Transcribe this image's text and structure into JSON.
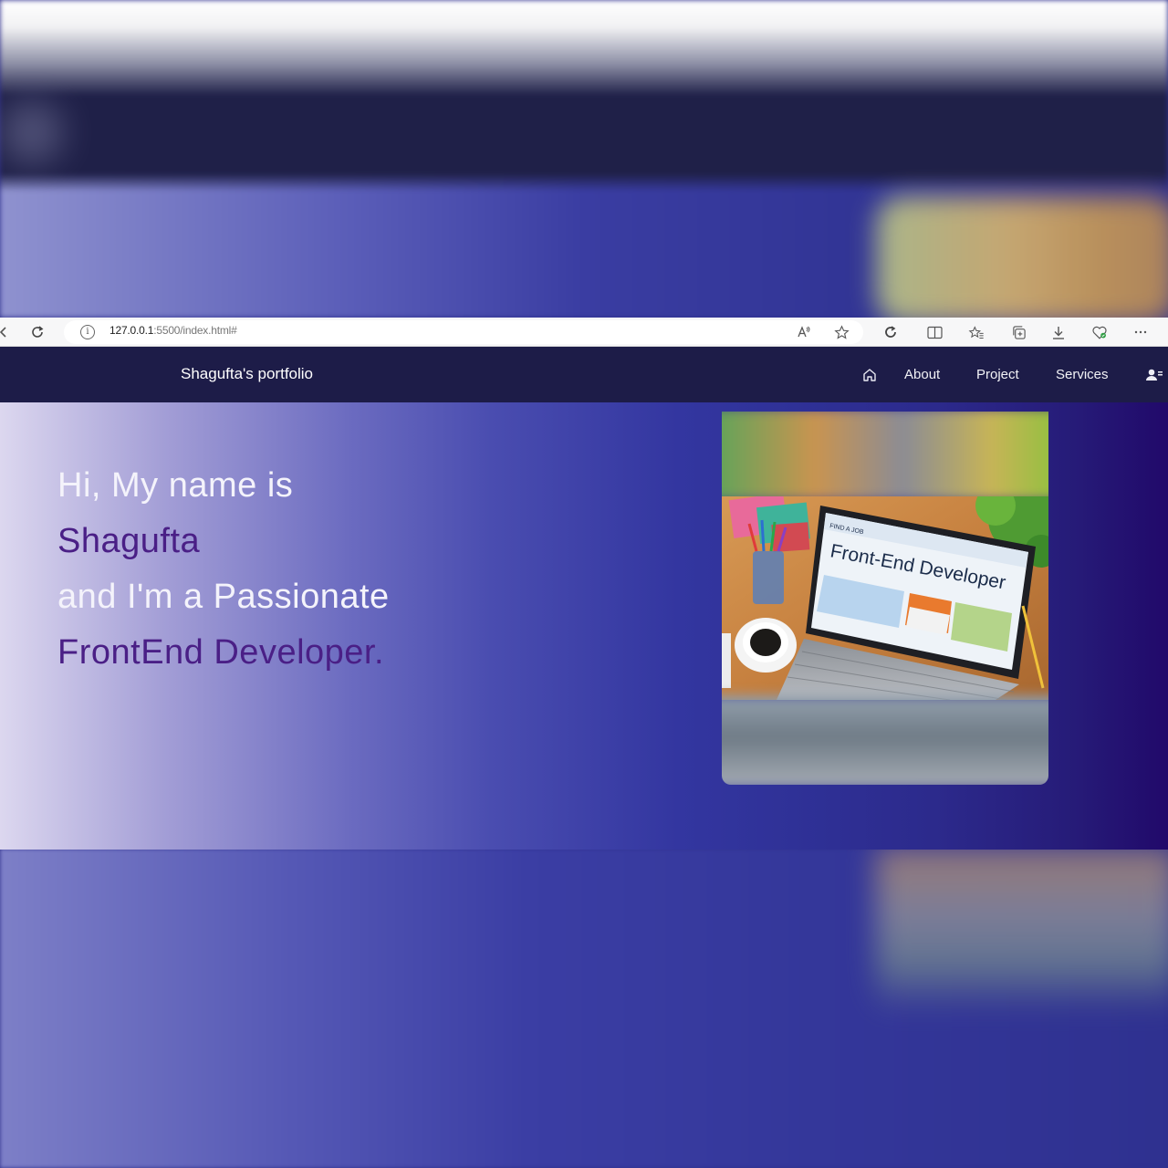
{
  "browser": {
    "address_host": "127.0.0.1",
    "address_path": ":5500/index.html#"
  },
  "nav": {
    "brand": "Shagufta's portfolio",
    "links": [
      {
        "label": "About"
      },
      {
        "label": "Project"
      },
      {
        "label": "Services"
      }
    ]
  },
  "hero": {
    "line1": "Hi, My name is",
    "line2": "Shagufta",
    "line3": "and I'm a Passionate",
    "line4": "FrontEnd Developer.",
    "image": {
      "screen_badge": "FIND A JOB",
      "screen_heading": "Front-End Developer"
    }
  },
  "colors": {
    "nav_bg": "#1d1c48",
    "accent_purple": "#4a1f86",
    "hero_text": "#f4f3fb"
  },
  "icons": [
    "back-icon",
    "refresh-icon",
    "info-icon",
    "read-aloud-icon",
    "favorite-star-icon",
    "extensions-icon",
    "split-screen-icon",
    "favorites-icon",
    "collections-icon",
    "download-icon",
    "browser-essentials-icon",
    "more-icon",
    "home-icon",
    "user-icon"
  ]
}
